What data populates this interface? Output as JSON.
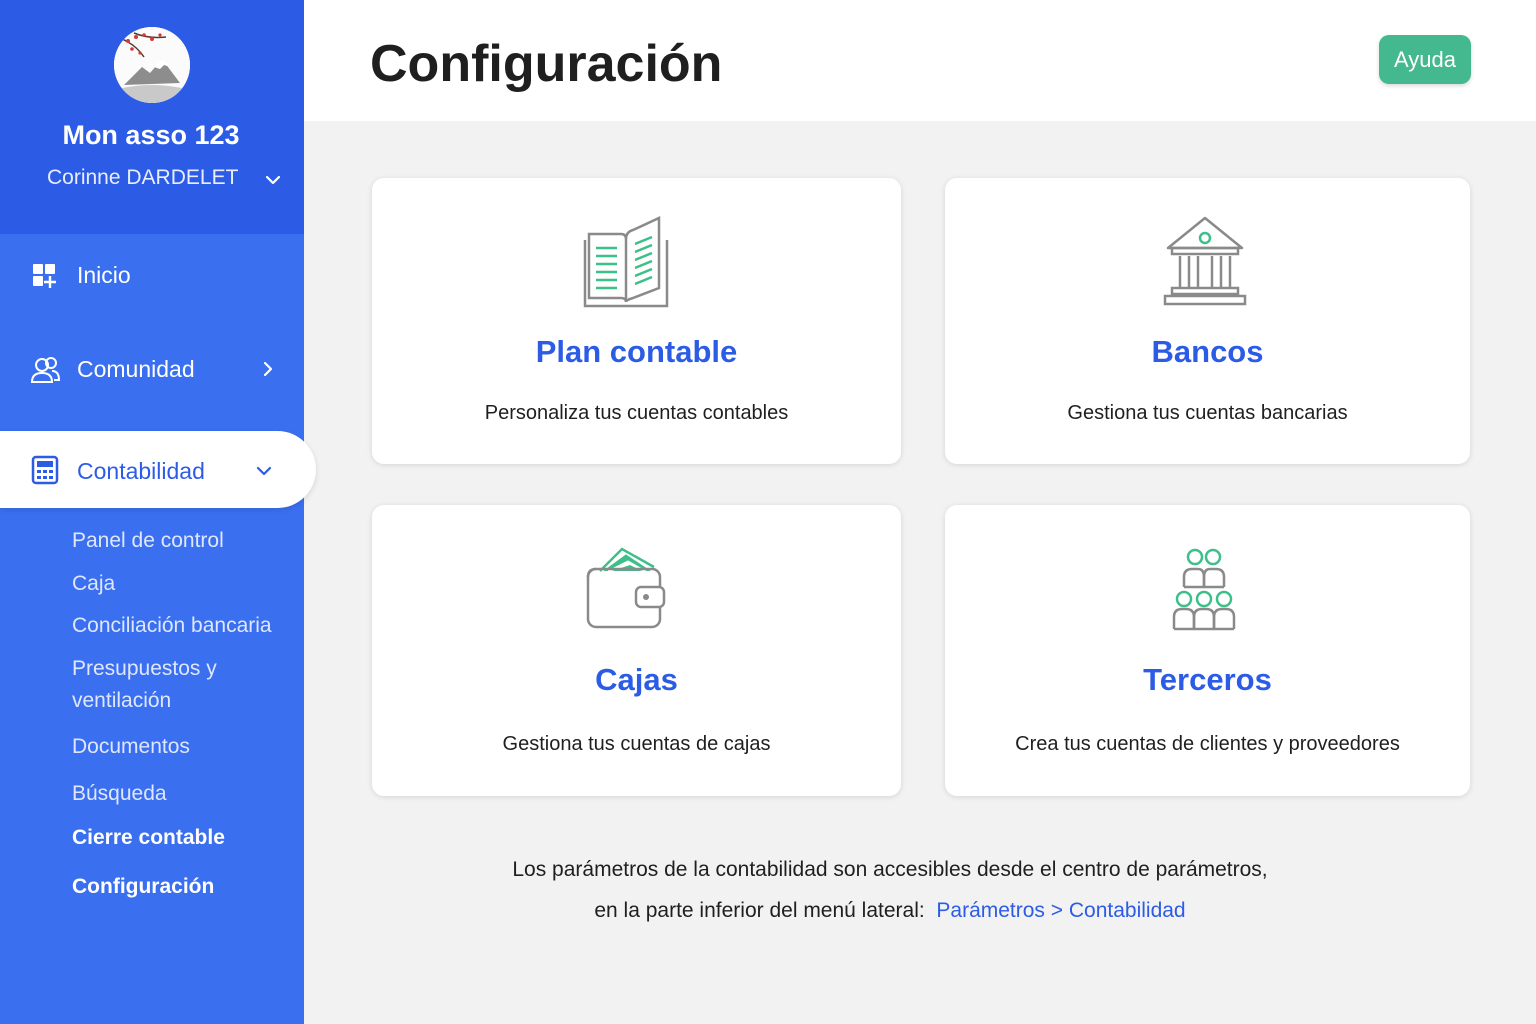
{
  "sidebar": {
    "org_name": "Mon asso 123",
    "user_name": "Corinne DARDELET",
    "nav": [
      {
        "label": "Inicio",
        "icon": "dashboard-icon"
      },
      {
        "label": "Comunidad",
        "icon": "users-icon"
      },
      {
        "label": "Contabilidad",
        "icon": "calculator-icon",
        "active": true
      }
    ],
    "sub_items": [
      {
        "label": "Panel de control"
      },
      {
        "label": "Caja"
      },
      {
        "label": "Conciliación bancaria"
      },
      {
        "label": "Presupuestos y ventilación"
      },
      {
        "label": "Documentos"
      },
      {
        "label": "Búsqueda"
      },
      {
        "label": "Cierre contable"
      },
      {
        "label": "Configuración"
      }
    ]
  },
  "header": {
    "title": "Configuración",
    "help_label": "Ayuda"
  },
  "cards": [
    {
      "title": "Plan contable",
      "description": "Personaliza tus cuentas contables",
      "icon": "open-book-icon"
    },
    {
      "title": "Bancos",
      "description": "Gestiona tus cuentas bancarias",
      "icon": "bank-icon"
    },
    {
      "title": "Cajas",
      "description": "Gestiona tus cuentas de cajas",
      "icon": "wallet-icon"
    },
    {
      "title": "Terceros",
      "description": "Crea tus cuentas de clientes y proveedores",
      "icon": "people-group-icon"
    }
  ],
  "info": {
    "line1": "Los parámetros de la contabilidad son accesibles desde el centro de parámetros,",
    "line2_prefix": "en la parte inferior del menú lateral:",
    "link": "Parámetros > Contabilidad"
  },
  "colors": {
    "sidebar": "#3a6ff0",
    "sidebar_header": "#2c5ce6",
    "accent": "#2c5ce6",
    "help_button": "#44b88f",
    "icon_green": "#3dbf8a",
    "icon_gray": "#8a8a8a"
  }
}
